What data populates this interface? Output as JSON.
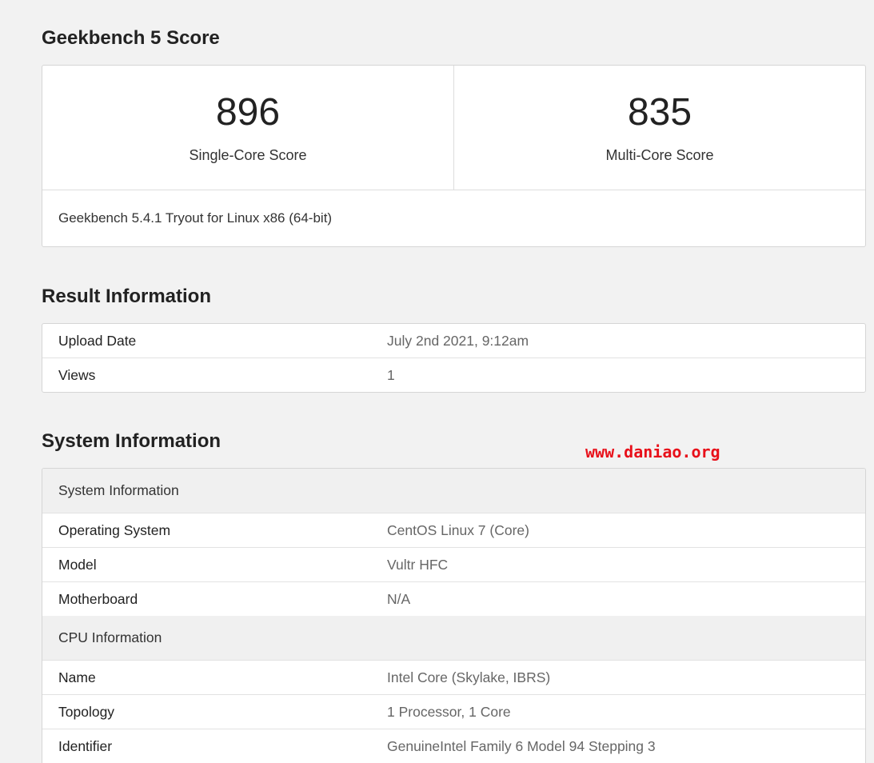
{
  "geekbench": {
    "title": "Geekbench 5 Score",
    "single_core": {
      "value": "896",
      "label": "Single-Core Score"
    },
    "multi_core": {
      "value": "835",
      "label": "Multi-Core Score"
    },
    "version": "Geekbench 5.4.1 Tryout for Linux x86 (64-bit)"
  },
  "result": {
    "title": "Result Information",
    "rows": [
      {
        "key": "Upload Date",
        "value": "July 2nd 2021, 9:12am"
      },
      {
        "key": "Views",
        "value": "1"
      }
    ]
  },
  "system": {
    "title": "System Information",
    "sections": [
      {
        "heading": "System Information",
        "rows": [
          {
            "key": "Operating System",
            "value": "CentOS Linux 7 (Core)"
          },
          {
            "key": "Model",
            "value": "Vultr HFC"
          },
          {
            "key": "Motherboard",
            "value": "N/A"
          }
        ]
      },
      {
        "heading": "CPU Information",
        "rows": [
          {
            "key": "Name",
            "value": "Intel Core (Skylake, IBRS)"
          },
          {
            "key": "Topology",
            "value": "1 Processor, 1 Core"
          },
          {
            "key": "Identifier",
            "value": "GenuineIntel Family 6 Model 94 Stepping 3"
          }
        ]
      }
    ]
  },
  "watermark": "www.daniao.org"
}
